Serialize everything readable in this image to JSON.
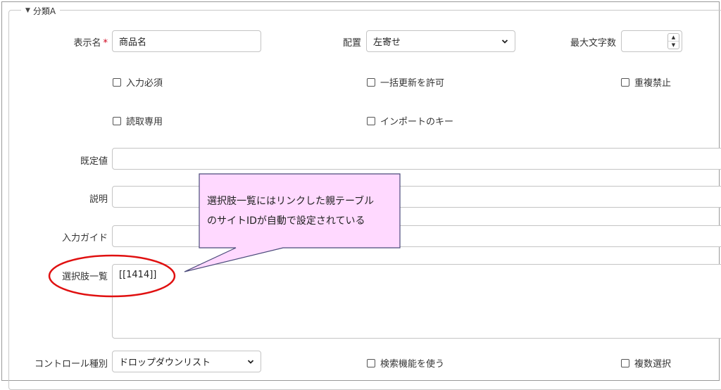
{
  "section": {
    "title": "分類A"
  },
  "fields": {
    "display_name": {
      "label": "表示名",
      "required_mark": "*",
      "value": "商品名"
    },
    "alignment": {
      "label": "配置",
      "value": "左寄せ"
    },
    "max_length": {
      "label": "最大文字数",
      "value": ""
    },
    "default_value": {
      "label": "既定値",
      "value": ""
    },
    "description": {
      "label": "説明",
      "value": ""
    },
    "input_guide": {
      "label": "入力ガイド",
      "value": ""
    },
    "choices": {
      "label": "選択肢一覧",
      "value": "[[1414]]"
    },
    "control_type": {
      "label": "コントロール種別",
      "value": "ドロップダウンリスト"
    }
  },
  "checkboxes": {
    "required": {
      "label": "入力必須",
      "checked": false
    },
    "bulk_update": {
      "label": "一括更新を許可",
      "checked": false
    },
    "no_duplicates": {
      "label": "重複禁止",
      "checked": false
    },
    "read_only": {
      "label": "読取専用",
      "checked": false
    },
    "import_key": {
      "label": "インポートのキー",
      "checked": false
    },
    "search_feature": {
      "label": "検索機能を使う",
      "checked": false
    },
    "multi_select": {
      "label": "複数選択",
      "checked": false
    }
  },
  "annotation": {
    "line1": "選択肢一覧にはリンクした親テーブル",
    "line2": "のサイトIDが自動で設定されている"
  },
  "colors": {
    "callout_fill": "#ffd9ff",
    "callout_border": "#4a4a7a",
    "highlight_ellipse": "#e01010",
    "required_mark": "#d0021b"
  },
  "icons": {
    "section_toggle": "caret-down-icon",
    "select_arrow": "chevron-down-icon",
    "spinner": "spinner-arrows-icon"
  }
}
